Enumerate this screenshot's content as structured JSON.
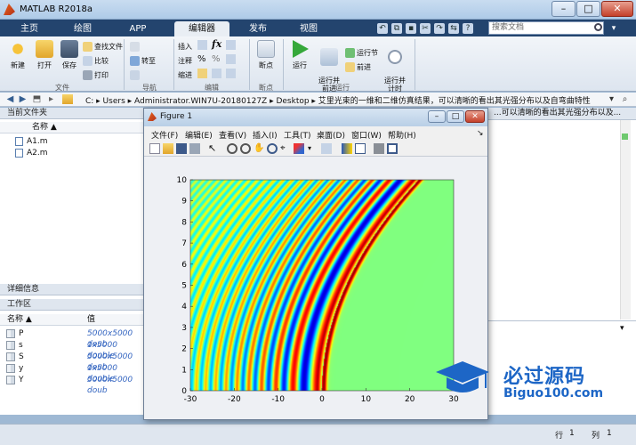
{
  "window": {
    "title": "MATLAB R2018a"
  },
  "ribbon_tabs": [
    "主页",
    "绘图",
    "APP",
    "编辑器",
    "发布",
    "视图"
  ],
  "active_tab": "编辑器",
  "search": {
    "placeholder": "搜索文档"
  },
  "ribbon": {
    "file_group": {
      "label": "文件",
      "new": "新建",
      "open": "打开",
      "save": "保存",
      "find_files": "查找文件",
      "compare": "比较",
      "print": "打印"
    },
    "nav_group": {
      "label": "导航",
      "goto": "转至"
    },
    "edit_group": {
      "label": "编辑",
      "insert": "插入",
      "comment": "注释",
      "indent": "缩进"
    },
    "breakpoints_group": {
      "label": "断点",
      "breakpoints": "断点"
    },
    "run_group": {
      "label": "运行",
      "run": "运行",
      "run_advance": "运行并\n前进",
      "run_section": "运行节",
      "advance": "前进",
      "run_time": "运行并\n计时"
    }
  },
  "address": {
    "path": "C: ▸ Users ▸ Administrator.WIN7U-20180127Z ▸ Desktop ▸ 艾里光束的一维和二维仿真结果，可以清晰的看出其光强分布以及自弯曲特性"
  },
  "current_folder": {
    "header": "当前文件夹",
    "col_name": "名称 ▲",
    "files": [
      "A1.m",
      "A2.m"
    ]
  },
  "details": {
    "header": "详细信息"
  },
  "workspace": {
    "header": "工作区",
    "col_name": "名称 ▲",
    "col_value": "值",
    "vars": [
      {
        "name": "P",
        "value": "5000x5000 doub"
      },
      {
        "name": "s",
        "value": "1x5000 double"
      },
      {
        "name": "S",
        "value": "5000x5000 doub"
      },
      {
        "name": "y",
        "value": "1x5000 double"
      },
      {
        "name": "Y",
        "value": "5000x5000 doub"
      }
    ]
  },
  "right_header": "...可以清晰的看出其光强分布以及...",
  "status": {
    "row_label": "行",
    "row": "1",
    "col_label": "列",
    "col": "1"
  },
  "figure": {
    "title": "Figure 1",
    "menu": [
      "文件(F)",
      "编辑(E)",
      "查看(V)",
      "插入(I)",
      "工具(T)",
      "桌面(D)",
      "窗口(W)",
      "帮助(H)"
    ]
  },
  "chart_data": {
    "type": "heatmap",
    "x_ticks": [
      "-30",
      "-20",
      "-10",
      "0",
      "10",
      "20",
      "30"
    ],
    "y_ticks": [
      "0",
      "1",
      "2",
      "3",
      "4",
      "5",
      "6",
      "7",
      "8",
      "9",
      "10"
    ],
    "xlim": [
      -30,
      30
    ],
    "ylim": [
      0,
      10
    ],
    "colormap": "jet"
  },
  "watermark": {
    "title": "必过源码",
    "url": "Biguo100.com"
  },
  "colors": {
    "tab_bar": "#23446e",
    "ribbon": "#e9eef4",
    "accent_blue": "#1d66c6"
  }
}
